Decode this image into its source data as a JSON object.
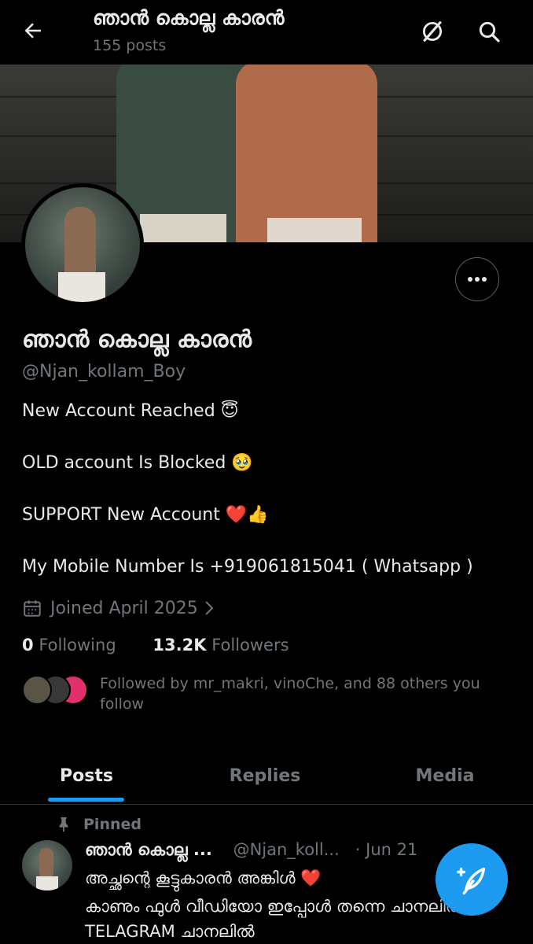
{
  "header": {
    "title": "ഞാൻ കൊല്ല കാരൻ",
    "post_count": "155 posts"
  },
  "profile": {
    "display_name": "ഞാൻ കൊല്ല കാരൻ",
    "handle": "@Njan_kollam_Boy",
    "bio": [
      "New Account Reached 😇",
      "OLD account Is Blocked 🥹",
      "SUPPORT New Account ❤️👍",
      "My Mobile Number Is +919061815041 ( Whatsapp )"
    ],
    "joined": "Joined April 2025",
    "following_count": "0",
    "following_label": "Following",
    "followers_count": "13.2K",
    "followers_label": "Followers",
    "followed_by_text": "Followed by mr_makri, vinoChe, and 88 others you follow"
  },
  "tabs": [
    {
      "label": "Posts",
      "active": true
    },
    {
      "label": "Replies",
      "active": false
    },
    {
      "label": "Media",
      "active": false
    }
  ],
  "post": {
    "pinned_label": "Pinned",
    "author_name": "ഞാൻ കൊല്ല ...",
    "author_handle": "@Njan_koll...",
    "date": "· Jun 21",
    "line1": "അച്ഛന്റെ കൂട്ടുകാരൻ അങ്കിൾ ❤️",
    "line2": "കാണും ഫുൾ വീഡിയോ ഇപ്പോൾ തന്നെ ചാനലിൽ",
    "line3": "TELAGRAM ചാനലിൽ"
  },
  "colors": {
    "accent": "#1d9bf0",
    "muted": "#71767b",
    "background": "#000000"
  }
}
